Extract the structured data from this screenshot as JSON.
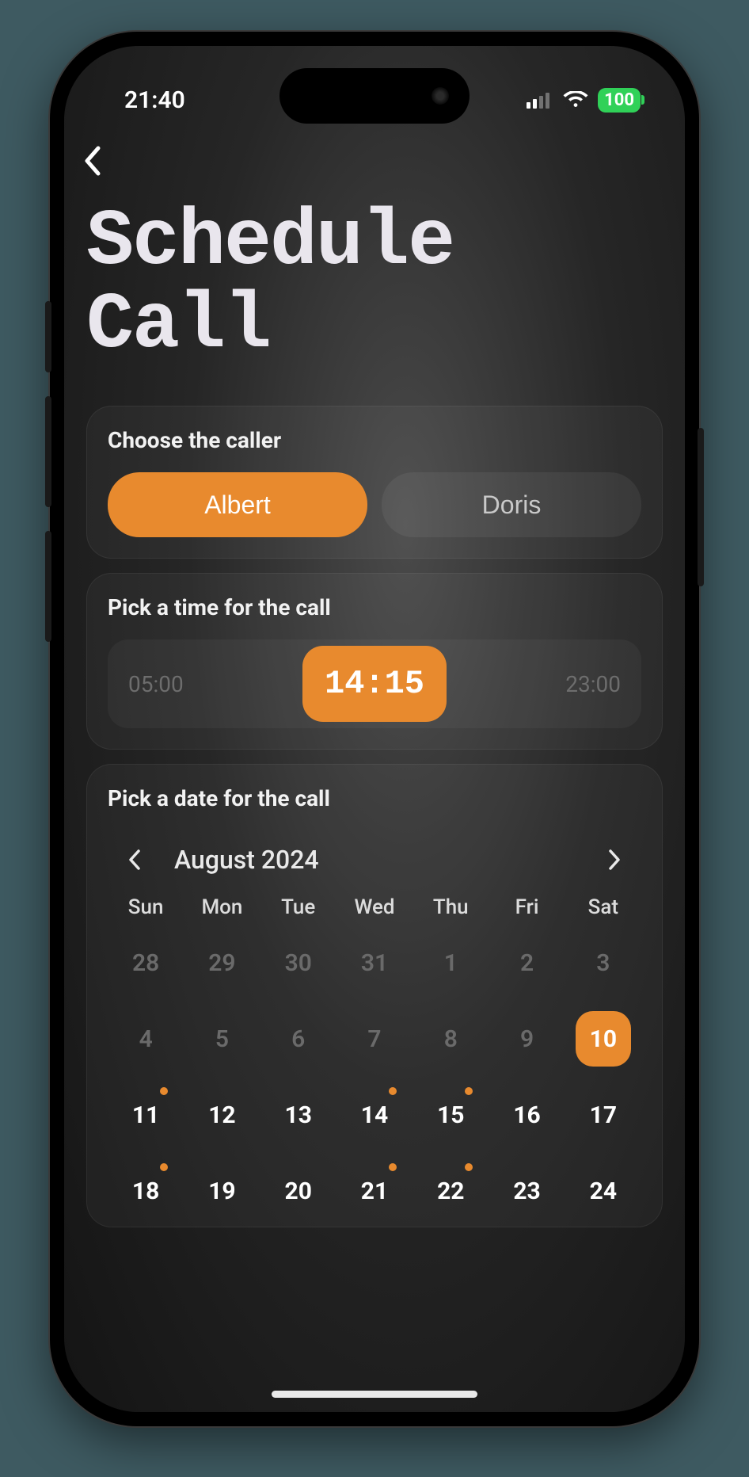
{
  "status": {
    "time": "21:40",
    "battery": "100"
  },
  "page": {
    "title": "Schedule Call"
  },
  "caller": {
    "label": "Choose the caller",
    "options": [
      {
        "name": "Albert",
        "selected": true
      },
      {
        "name": "Doris",
        "selected": false
      }
    ]
  },
  "time": {
    "label": "Pick a time for the call",
    "min": "05:00",
    "value": "14:15",
    "max": "23:00"
  },
  "date": {
    "label": "Pick a date for the call",
    "month": "August 2024",
    "dow": [
      "Sun",
      "Mon",
      "Tue",
      "Wed",
      "Thu",
      "Fri",
      "Sat"
    ],
    "days": [
      {
        "n": "28",
        "muted": true
      },
      {
        "n": "29",
        "muted": true
      },
      {
        "n": "30",
        "muted": true
      },
      {
        "n": "31",
        "muted": true
      },
      {
        "n": "1",
        "muted": true
      },
      {
        "n": "2",
        "muted": true
      },
      {
        "n": "3",
        "muted": true
      },
      {
        "n": "4",
        "muted": true
      },
      {
        "n": "5",
        "muted": true
      },
      {
        "n": "6",
        "muted": true
      },
      {
        "n": "7",
        "muted": true
      },
      {
        "n": "8",
        "muted": true
      },
      {
        "n": "9",
        "muted": true
      },
      {
        "n": "10",
        "selected": true
      },
      {
        "n": "11",
        "dot": true
      },
      {
        "n": "12"
      },
      {
        "n": "13"
      },
      {
        "n": "14",
        "dot": true
      },
      {
        "n": "15",
        "dot": true
      },
      {
        "n": "16"
      },
      {
        "n": "17"
      },
      {
        "n": "18",
        "dot": true
      },
      {
        "n": "19"
      },
      {
        "n": "20"
      },
      {
        "n": "21",
        "dot": true
      },
      {
        "n": "22",
        "dot": true
      },
      {
        "n": "23"
      },
      {
        "n": "24"
      }
    ]
  },
  "colors": {
    "accent": "#e88a2e"
  }
}
